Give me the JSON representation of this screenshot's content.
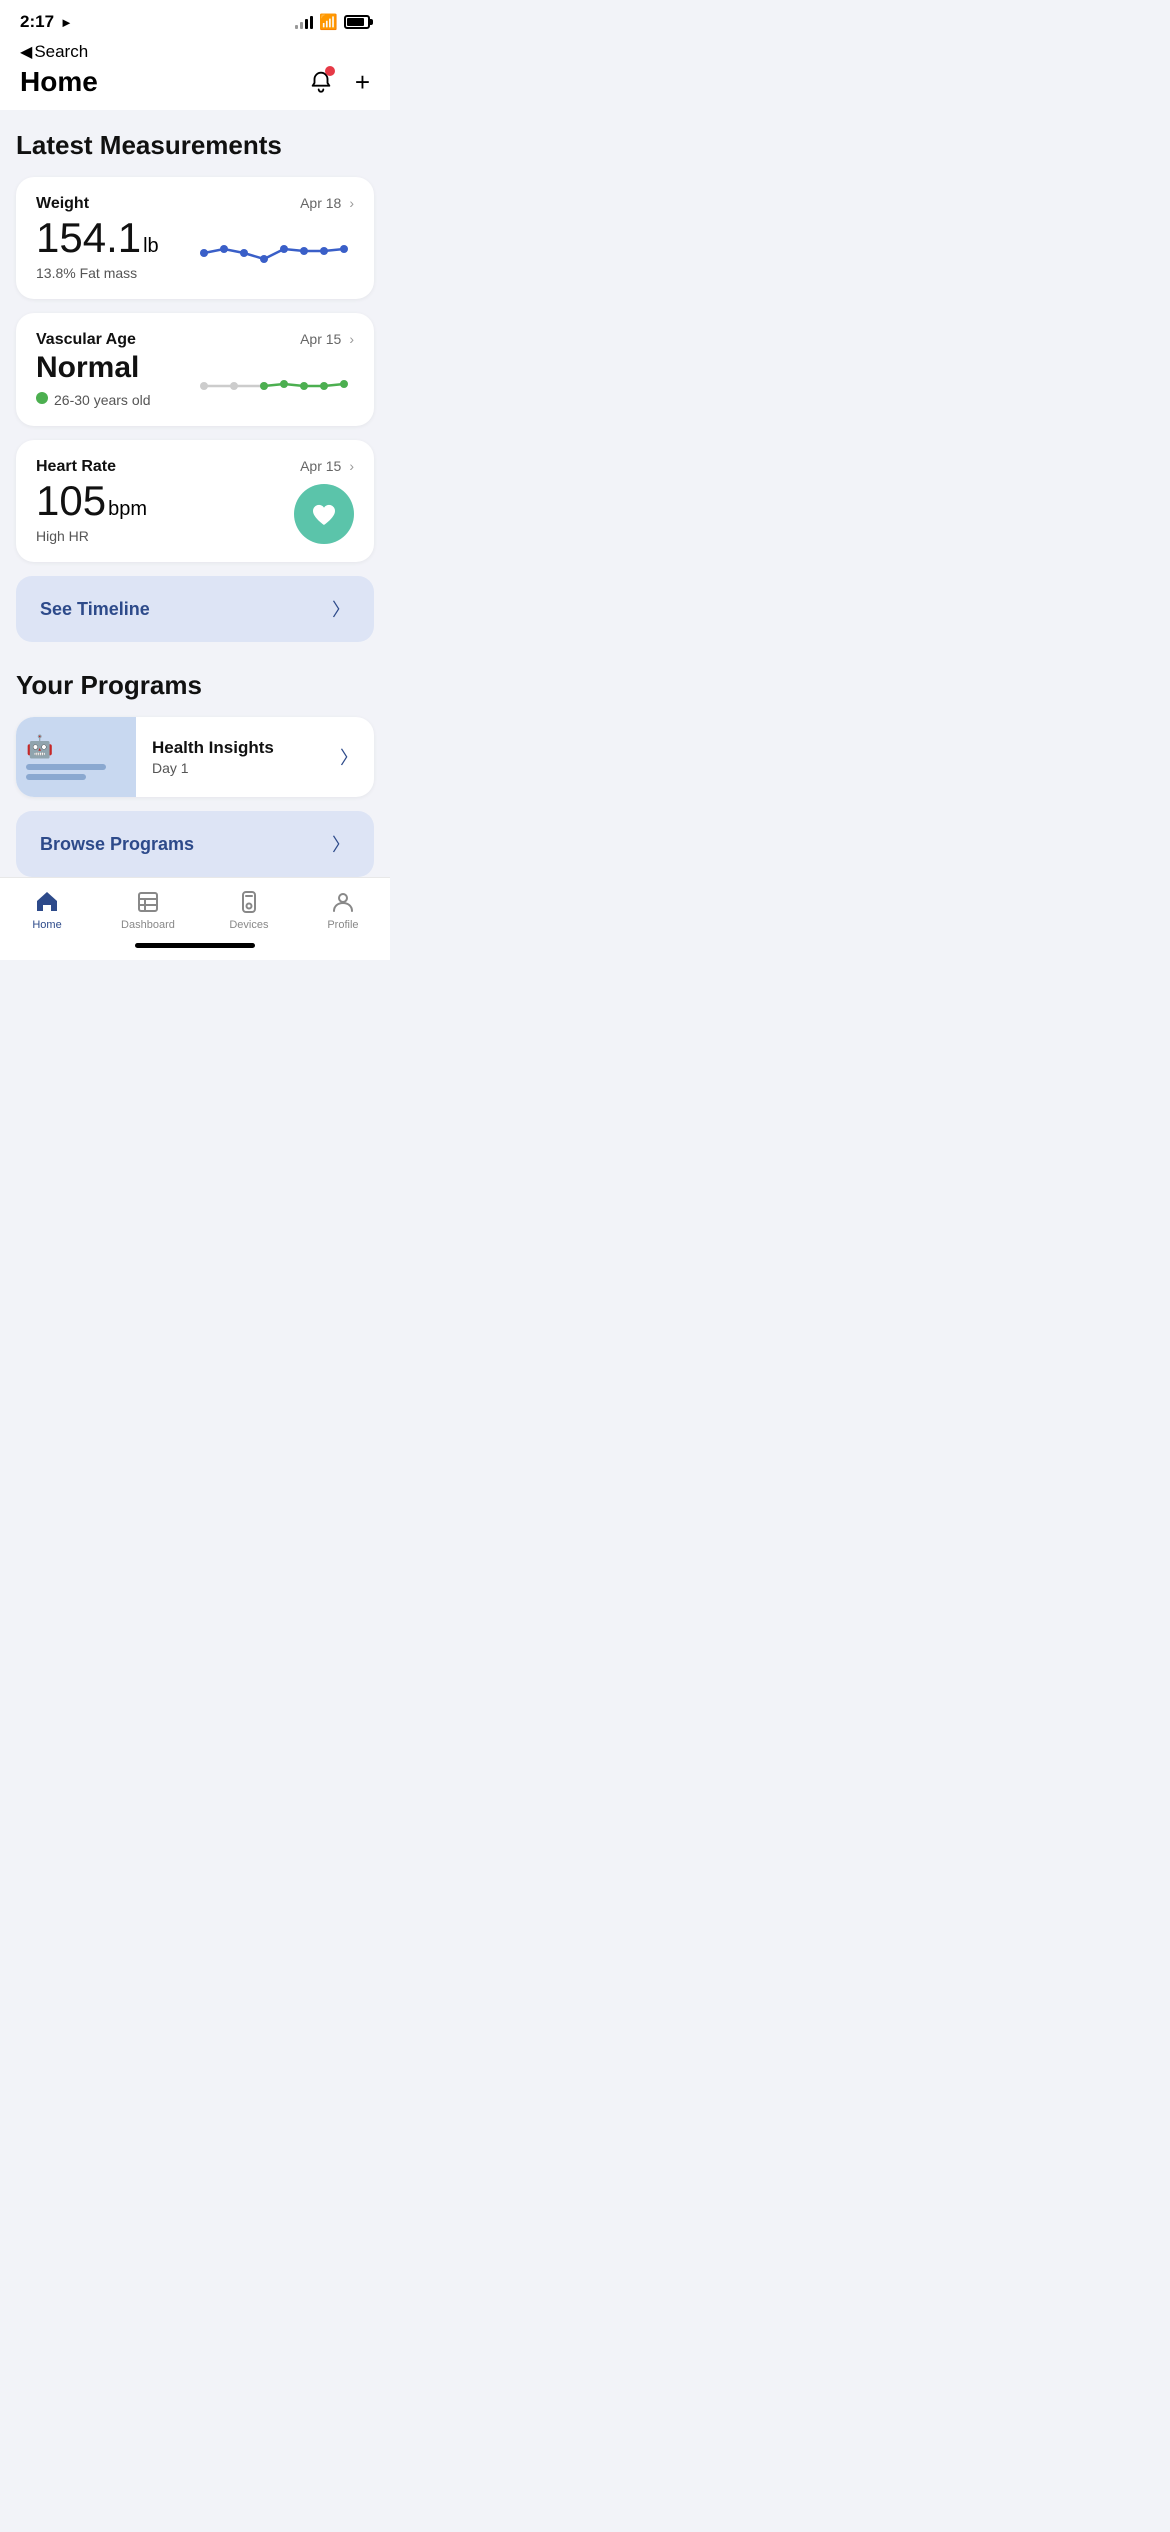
{
  "statusBar": {
    "time": "2:17",
    "navIcon": "▶",
    "backLabel": "Search"
  },
  "header": {
    "title": "Home",
    "notificationBadge": true,
    "addButton": "+"
  },
  "latestMeasurements": {
    "sectionTitle": "Latest Measurements",
    "cards": [
      {
        "id": "weight",
        "label": "Weight",
        "date": "Apr 18",
        "value": "154.1",
        "unit": "lb",
        "subtitle": "13.8% Fat mass",
        "chartType": "line"
      },
      {
        "id": "vascular",
        "label": "Vascular Age",
        "valueLine1": "Normal",
        "date": "Apr 15",
        "subtitle": "26-30 years old",
        "chartType": "line-green"
      },
      {
        "id": "heartrate",
        "label": "Heart Rate",
        "date": "Apr 15",
        "value": "105",
        "unit": "bpm",
        "subtitle": "High HR",
        "chartType": "heart"
      }
    ]
  },
  "timelineButton": {
    "label": "See Timeline",
    "chevron": "›"
  },
  "programs": {
    "sectionTitle": "Your Programs",
    "items": [
      {
        "title": "Health Insights",
        "subtitle": "Day 1"
      }
    ],
    "browseLabel": "Browse Programs",
    "browseChevron": "›"
  },
  "tabBar": {
    "items": [
      {
        "id": "home",
        "label": "Home",
        "active": true
      },
      {
        "id": "dashboard",
        "label": "Dashboard",
        "active": false
      },
      {
        "id": "devices",
        "label": "Devices",
        "active": false
      },
      {
        "id": "profile",
        "label": "Profile",
        "active": false
      }
    ]
  }
}
